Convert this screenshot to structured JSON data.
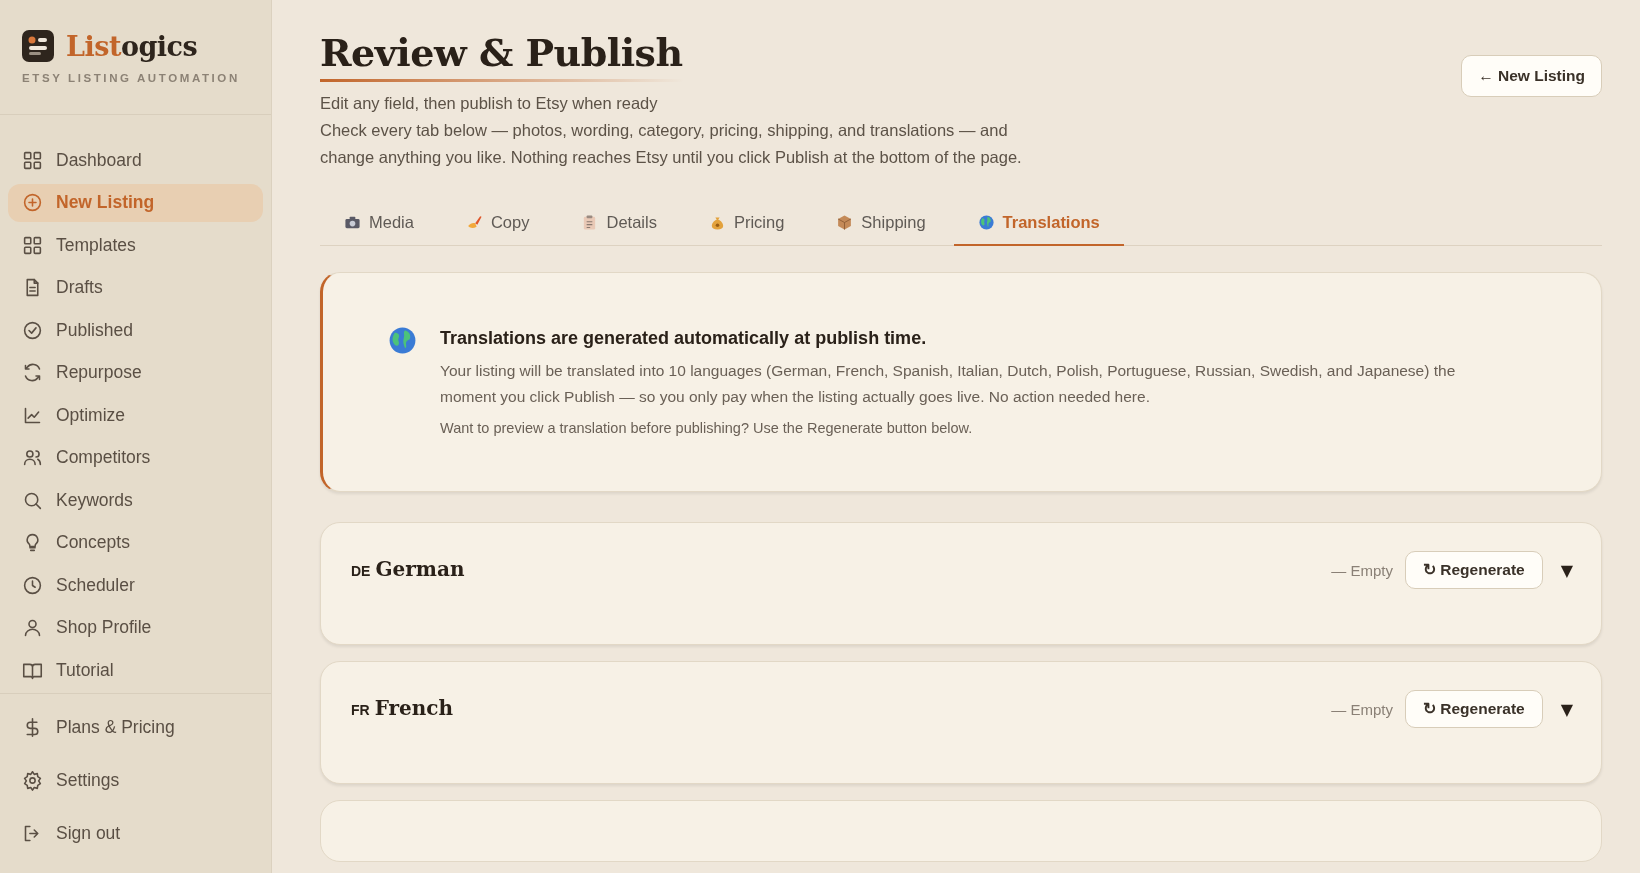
{
  "brand": {
    "name_part_1": "List",
    "name_part_2": "ogics",
    "tagline": "ETSY LISTING AUTOMATION"
  },
  "sidebar": {
    "items": [
      {
        "label": "Dashboard",
        "selected": false
      },
      {
        "label": "New Listing",
        "selected": true
      },
      {
        "label": "Templates",
        "selected": false
      },
      {
        "label": "Drafts",
        "selected": false
      },
      {
        "label": "Published",
        "selected": false
      },
      {
        "label": "Repurpose",
        "selected": false
      },
      {
        "label": "Optimize",
        "selected": false
      },
      {
        "label": "Competitors",
        "selected": false
      },
      {
        "label": "Keywords",
        "selected": false
      },
      {
        "label": "Concepts",
        "selected": false
      },
      {
        "label": "Scheduler",
        "selected": false
      },
      {
        "label": "Shop Profile",
        "selected": false
      },
      {
        "label": "Tutorial",
        "selected": false
      }
    ],
    "footer_items": [
      {
        "label": "Plans & Pricing"
      },
      {
        "label": "Settings"
      },
      {
        "label": "Sign out"
      }
    ]
  },
  "header": {
    "title": "Review & Publish",
    "subtitle": "Edit any field, then publish to Etsy when ready",
    "description": "Check every tab below — photos, wording, category, pricing, shipping, and translations — and change anything you like. Nothing reaches Etsy until you click Publish at the bottom of the page.",
    "back_button": "← New Listing"
  },
  "tabs": [
    {
      "label": "Media",
      "selected": false
    },
    {
      "label": "Copy",
      "selected": false
    },
    {
      "label": "Details",
      "selected": false
    },
    {
      "label": "Pricing",
      "selected": false
    },
    {
      "label": "Shipping",
      "selected": false
    },
    {
      "label": "Translations",
      "selected": true
    }
  ],
  "notice": {
    "title": "Translations are generated automatically at publish time.",
    "body": "Your listing will be translated into 10 languages (German, French, Spanish, Italian, Dutch, Polish, Portuguese, Russian, Swedish, and Japanese) the moment you click Publish — so you only pay when the listing actually goes live. No action needed here.",
    "hint": "Want to preview a translation before publishing? Use the Regenerate button below."
  },
  "languages": [
    {
      "code": "DE",
      "name": "German",
      "status": "— Empty",
      "button": "↻ Regenerate",
      "toggle": "▼"
    },
    {
      "code": "FR",
      "name": "French",
      "status": "— Empty",
      "button": "↻ Regenerate",
      "toggle": "▼"
    }
  ]
}
